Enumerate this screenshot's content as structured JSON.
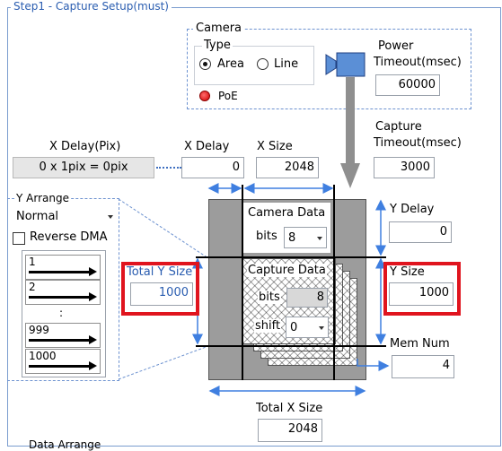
{
  "step1": {
    "title": "Step1 - Capture Setup(must)"
  },
  "camera": {
    "group_label": "Camera",
    "type_label": "Type",
    "type_options": [
      "Area",
      "Line"
    ],
    "type_selected": "Area",
    "poe_label": "PoE"
  },
  "power_timeout": {
    "label_line1": "Power",
    "label_line2": "Timeout(msec)",
    "value": "60000"
  },
  "capture_timeout": {
    "label_line1": "Capture",
    "label_line2": "Timeout(msec)",
    "value": "3000"
  },
  "x_delay_pix": {
    "label": "X Delay(Pix)",
    "value": "0 x 1pix = 0pix"
  },
  "x_delay": {
    "label": "X Delay",
    "value": "0"
  },
  "x_size": {
    "label": "X Size",
    "value": "2048"
  },
  "y_arrange": {
    "group_label": "Y Arrange",
    "selected": "Normal",
    "reverse_dma_label": "Reverse DMA",
    "lines": [
      "1",
      "2",
      ":",
      "999",
      "1000"
    ]
  },
  "camera_data": {
    "title": "Camera Data",
    "bits_label": "bits",
    "bits_value": "8"
  },
  "capture_data": {
    "title": "Capture Data",
    "bits_label": "bits",
    "bits_value": "8",
    "shift_label": "shift",
    "shift_value": "0"
  },
  "y_delay": {
    "label": "Y Delay",
    "value": "0"
  },
  "total_y_size": {
    "label": "Total Y Size",
    "value": "1000"
  },
  "y_size": {
    "label": "Y Size",
    "value": "1000"
  },
  "mem_num": {
    "label": "Mem Num",
    "value": "4"
  },
  "total_x_size": {
    "label": "Total X Size",
    "value": "2048"
  },
  "data_arrange": {
    "label": "Data Arrange"
  },
  "colors": {
    "accent": "#2a5db0",
    "highlight": "#e0141e",
    "arrow_blue": "#3f7fe0",
    "gray_block": "#9c9c9c"
  }
}
